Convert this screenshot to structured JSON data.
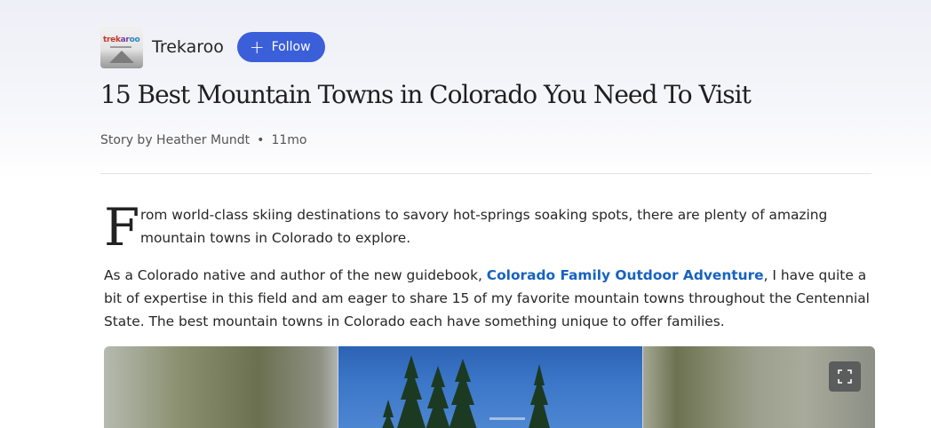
{
  "publisher": {
    "logo_text": "trekaroo",
    "name": "Trekaroo",
    "follow_label": "Follow"
  },
  "article": {
    "title": "15 Best Mountain Towns in Colorado You Need To Visit",
    "byline": "Story by Heather Mundt",
    "age": "11mo",
    "dropcap": "F",
    "para1_rest": "rom world-class skiing destinations to savory hot-springs soaking spots, there are plenty of amazing mountain towns in Colorado to explore.",
    "para2_before": "As a Colorado native and author of the new guidebook, ",
    "para2_link": "Colorado Family Outdoor Adventure",
    "para2_after": ", I have quite a bit of expertise in this field and am eager to share 15 of my favorite mountain towns throughout the Centennial State. The best mountain towns in Colorado each have something unique to offer families."
  },
  "colors": {
    "follow_button": "#3b5fd9",
    "link": "#1762c0",
    "sky": "#3b76c8"
  },
  "icons": {
    "follow": "plus-icon",
    "expand": "fullscreen-icon"
  }
}
